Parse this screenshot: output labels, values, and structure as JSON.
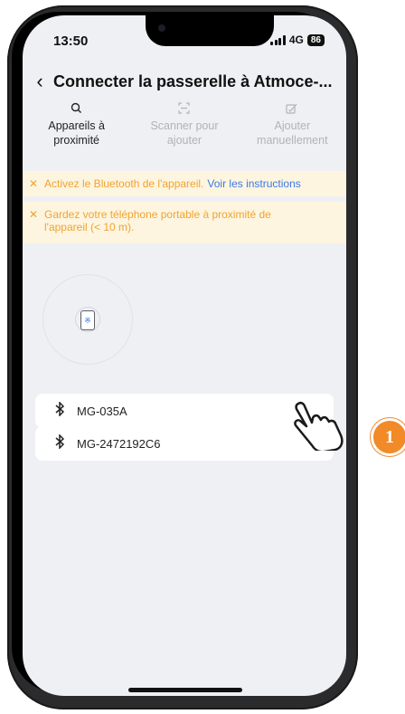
{
  "status_bar": {
    "time": "13:50",
    "network": "4G",
    "battery": "86"
  },
  "header": {
    "title": "Connecter la passerelle à Atmoce-..."
  },
  "tabs": [
    {
      "icon": "search-icon",
      "label": "Appareils à proximité",
      "active": true
    },
    {
      "icon": "scan-icon",
      "label": "Scanner pour ajouter",
      "active": false
    },
    {
      "icon": "edit-icon",
      "label": "Ajouter manuellement",
      "active": false
    }
  ],
  "banners": {
    "bluetooth": {
      "text": "Activez le Bluetooth de l'appareil.",
      "link": "Voir les instructions"
    },
    "proximity": {
      "text": "Gardez votre téléphone portable à proximité de l'appareil (< 10 m)."
    }
  },
  "devices": [
    {
      "name": "MG-035A"
    },
    {
      "name": "MG-2472192C6"
    }
  ],
  "annotation": {
    "step": "1"
  },
  "colors": {
    "accent_link": "#3b78e7",
    "warning": "#f0a330",
    "step_badge": "#f18a27"
  }
}
